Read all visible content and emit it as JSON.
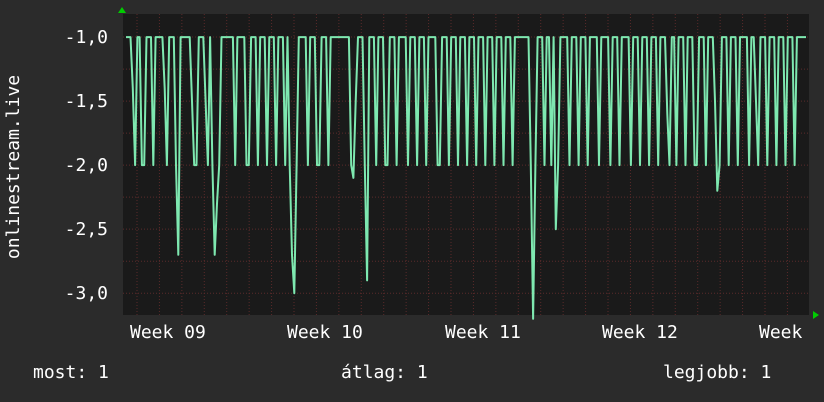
{
  "chart_data": {
    "type": "line",
    "ylabel": "onlinestream.live",
    "ylim": [
      -3.17,
      -0.82
    ],
    "yticks": [
      -1.0,
      -1.5,
      -2.0,
      -2.5,
      -3.0
    ],
    "ytick_labels": [
      "-1,0",
      "-1,5",
      "-2,0",
      "-2,5",
      "-3,0"
    ],
    "x_tick_labels": [
      "Week 09",
      "Week 10",
      "Week 11",
      "Week 12",
      "Week"
    ],
    "colors": {
      "line": "#7ee8b0",
      "background": "#2b2b2b",
      "plot": "#1a1a1a",
      "grid": "#5a2a2a",
      "axis_arrow": "#00cc00"
    },
    "series": [
      {
        "values": [
          -1.0,
          -1.0,
          -1.0,
          -1.4,
          -2.0,
          -1.0,
          -1.0,
          -2.0,
          -2.0,
          -1.0,
          -1.0,
          -1.0,
          -2.0,
          -1.0,
          -1.0,
          -1.0,
          -1.0,
          -1.4,
          -2.0,
          -1.0,
          -1.0,
          -1.0,
          -2.0,
          -2.7,
          -1.0,
          -1.0,
          -1.0,
          -1.0,
          -1.0,
          -1.5,
          -2.0,
          -2.0,
          -1.0,
          -1.0,
          -1.0,
          -1.5,
          -2.0,
          -1.0,
          -2.0,
          -2.7,
          -2.3,
          -2.0,
          -1.0,
          -1.0,
          -1.0,
          -1.0,
          -1.0,
          -1.0,
          -2.0,
          -1.0,
          -1.0,
          -1.0,
          -1.0,
          -2.0,
          -2.0,
          -1.0,
          -1.0,
          -1.0,
          -2.0,
          -1.0,
          -1.0,
          -1.0,
          -2.0,
          -1.0,
          -1.0,
          -1.0,
          -2.0,
          -1.0,
          -1.0,
          -1.0,
          -2.0,
          -1.0,
          -2.0,
          -2.7,
          -3.0,
          -2.0,
          -1.0,
          -1.0,
          -1.0,
          -1.0,
          -2.0,
          -1.0,
          -1.0,
          -1.0,
          -2.0,
          -2.0,
          -1.0,
          -1.0,
          -1.0,
          -2.0,
          -1.0,
          -1.0,
          -1.0,
          -1.0,
          -1.0,
          -1.0,
          -1.0,
          -1.0,
          -1.0,
          -2.0,
          -2.1,
          -1.5,
          -1.0,
          -1.0,
          -1.0,
          -2.0,
          -2.9,
          -1.0,
          -1.0,
          -1.0,
          -2.0,
          -1.0,
          -1.0,
          -1.0,
          -2.0,
          -2.0,
          -1.0,
          -1.0,
          -1.0,
          -2.0,
          -1.0,
          -1.0,
          -1.0,
          -1.0,
          -2.0,
          -1.0,
          -1.0,
          -1.0,
          -2.0,
          -1.0,
          -1.0,
          -1.0,
          -2.0,
          -1.0,
          -1.0,
          -1.0,
          -1.0,
          -2.0,
          -2.0,
          -1.0,
          -1.0,
          -1.0,
          -2.0,
          -1.0,
          -1.0,
          -1.0,
          -2.0,
          -1.0,
          -1.0,
          -1.0,
          -2.0,
          -1.0,
          -1.0,
          -1.0,
          -2.0,
          -1.0,
          -1.0,
          -1.0,
          -2.0,
          -1.0,
          -1.0,
          -1.0,
          -2.0,
          -1.0,
          -1.0,
          -1.0,
          -2.0,
          -1.0,
          -1.0,
          -1.0,
          -2.0,
          -1.0,
          -1.0,
          -1.0,
          -1.0,
          -1.0,
          -1.0,
          -1.0,
          -2.0,
          -3.2,
          -2.0,
          -1.0,
          -1.0,
          -1.0,
          -2.0,
          -1.0,
          -1.0,
          -2.0,
          -1.0,
          -2.5,
          -2.0,
          -1.0,
          -1.0,
          -1.0,
          -1.0,
          -2.0,
          -1.0,
          -1.0,
          -1.0,
          -2.0,
          -1.0,
          -1.0,
          -1.0,
          -2.0,
          -1.0,
          -1.0,
          -1.0,
          -1.0,
          -2.0,
          -1.0,
          -1.0,
          -1.0,
          -1.0,
          -2.0,
          -1.0,
          -1.0,
          -1.0,
          -2.0,
          -1.0,
          -1.0,
          -1.0,
          -1.0,
          -2.0,
          -1.0,
          -1.0,
          -1.0,
          -2.0,
          -1.0,
          -1.0,
          -1.0,
          -2.0,
          -1.0,
          -1.0,
          -1.0,
          -2.0,
          -1.0,
          -1.0,
          -1.0,
          -1.6,
          -2.0,
          -1.0,
          -1.0,
          -2.0,
          -1.0,
          -1.0,
          -1.0,
          -2.0,
          -1.0,
          -1.0,
          -1.0,
          -2.0,
          -2.0,
          -1.0,
          -1.0,
          -1.0,
          -2.0,
          -1.0,
          -1.0,
          -1.0,
          -1.5,
          -2.2,
          -2.0,
          -1.0,
          -1.0,
          -1.0,
          -2.0,
          -1.0,
          -1.0,
          -1.0,
          -2.0,
          -1.0,
          -1.0,
          -1.0,
          -1.0,
          -2.0,
          -1.0,
          -1.0,
          -1.5,
          -2.0,
          -1.0,
          -1.0,
          -1.0,
          -2.0,
          -1.0,
          -1.0,
          -1.0,
          -2.0,
          -1.0,
          -1.0,
          -1.0,
          -2.0,
          -1.0,
          -1.0,
          -1.0,
          -2.0,
          -1.0,
          -1.0,
          -1.0,
          -1.0,
          -1.0
        ]
      }
    ]
  },
  "legend": {
    "now": "most: 1",
    "avg": "átlag: 1",
    "max": "legjobb: 1"
  }
}
